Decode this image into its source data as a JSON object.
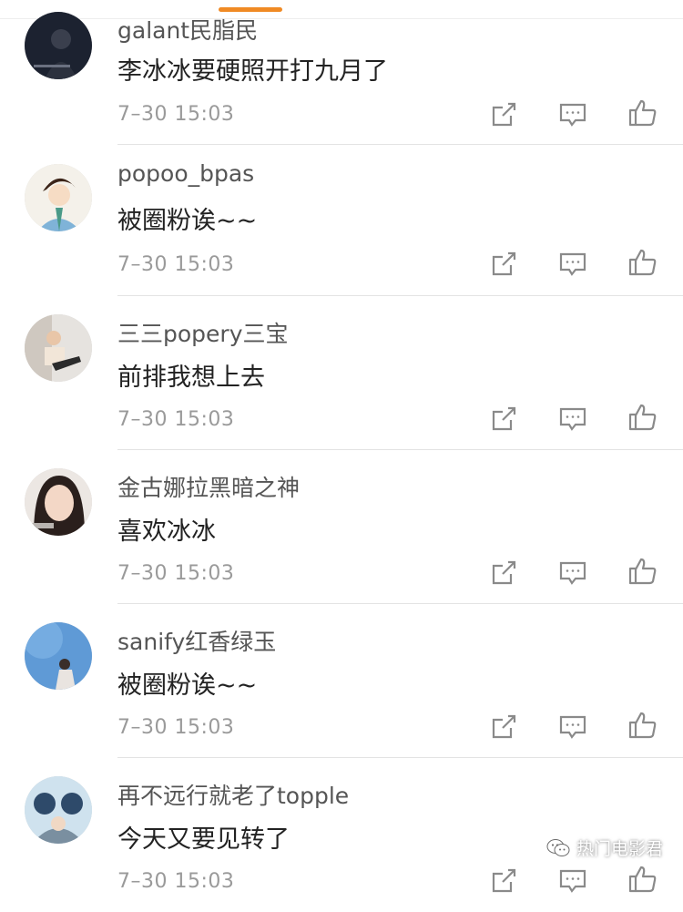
{
  "colors": {
    "accent": "#f08a24",
    "username": "#555555",
    "text": "#222222",
    "time": "#9a9a9a",
    "divider": "#e3e3e3",
    "icon": "#8a8a8a"
  },
  "comments": [
    {
      "username": "galant民脂民",
      "text": "李冰冰要硬照开打九月了",
      "time": "7–30 15:03"
    },
    {
      "username": "popoo_bpas",
      "text": "被圈粉诶~~",
      "time": "7–30 15:03"
    },
    {
      "username": "三三popery三宝",
      "text": "前排我想上去",
      "time": "7–30 15:03"
    },
    {
      "username": "金古娜拉黑暗之神",
      "text": "喜欢冰冰",
      "time": "7–30 15:03"
    },
    {
      "username": "sanify红香绿玉",
      "text": "被圈粉诶~~",
      "time": "7–30 15:03"
    },
    {
      "username": "再不远行就老了topple",
      "text": "今天又要见转了",
      "time": "7–30 15:03"
    }
  ],
  "watermark": {
    "text": "热门电影君",
    "icon": "wechat-icon"
  }
}
